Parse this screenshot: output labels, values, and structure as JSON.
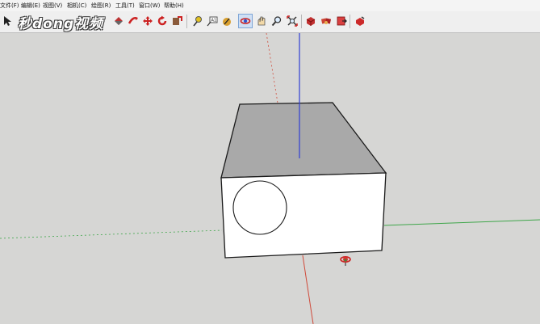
{
  "menu": {
    "items": [
      "文件(F)",
      "编辑(E)",
      "视图(V)",
      "相机(C)",
      "绘图(R)",
      "工具(T)",
      "窗口(W)",
      "帮助(H)"
    ]
  },
  "logo": {
    "text": "秒dong视频"
  },
  "toolbar": {
    "tools": [
      "select-tool",
      "paint-bucket-tool",
      "push-pull-tool",
      "follow-me-tool",
      "move-tool",
      "rotate-tool",
      "offset-tool",
      "tape-measure-tool",
      "text-tool",
      "axes-tool",
      "orbit-tool",
      "pan-tool",
      "zoom-tool",
      "zoom-extents-tool",
      "components-tool",
      "materials-tool",
      "warehouse-tool",
      "extension-tool"
    ],
    "active_tool": "orbit-tool"
  },
  "colors": {
    "background": "#d6d6d4",
    "red_axis": "#d04a3a",
    "green_axis": "#3fa64a",
    "blue_axis": "#2f3fd4",
    "top_face": "#a9a9a9",
    "front_face": "#ffffff"
  }
}
